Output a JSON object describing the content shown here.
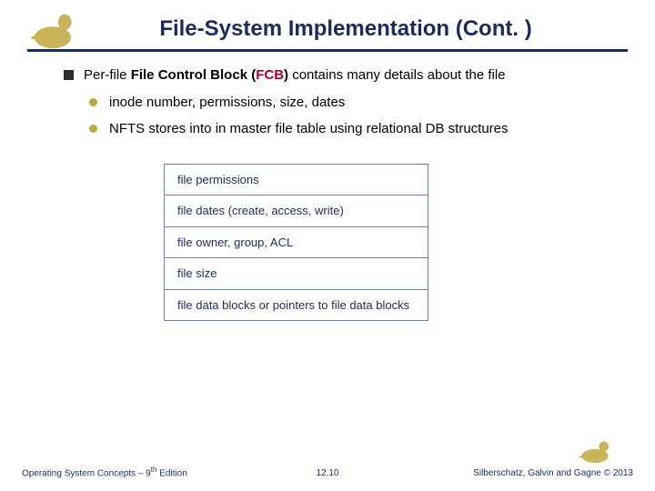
{
  "title": "File-System Implementation (Cont. )",
  "bullet1": {
    "pre": "Per-file ",
    "bold1": "File Control Block (",
    "fcb": "FCB",
    "bold2": ")",
    "post": " contains many details about the file"
  },
  "sub1": "inode number, permissions, size, dates",
  "sub2": "NFTS stores into in master file table  using relational DB structures",
  "fig_rows": {
    "r0": "file permissions",
    "r1": "file dates (create, access, write)",
    "r2": "file owner, group, ACL",
    "r3": "file size",
    "r4": "file data blocks or pointers to file data blocks"
  },
  "footer": {
    "left_pre": "Operating System Concepts – 9",
    "left_sup": "th",
    "left_post": " Edition",
    "center": "12.10",
    "right": "Silberschatz, Galvin and Gagne © 2013"
  }
}
